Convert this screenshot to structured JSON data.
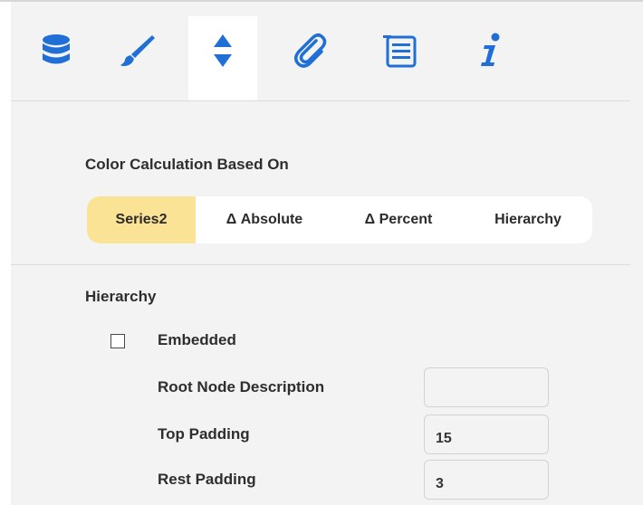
{
  "tabs": [
    {
      "icon": "database-icon",
      "active": false
    },
    {
      "icon": "brush-icon",
      "active": false
    },
    {
      "icon": "sort-arrows-icon",
      "active": true
    },
    {
      "icon": "paperclip-icon",
      "active": false
    },
    {
      "icon": "list-icon",
      "active": false
    },
    {
      "icon": "info-icon",
      "active": false
    }
  ],
  "colors": {
    "icon_blue": "#1f6fd6",
    "selected_segment": "#fbe396",
    "panel_bg": "#f3f3f3"
  },
  "color_calculation": {
    "title": "Color Calculation Based On",
    "options": [
      "Series2",
      "Δ Absolute",
      "Δ Percent",
      "Hierarchy"
    ],
    "selected": "Series2"
  },
  "hierarchy": {
    "title": "Hierarchy",
    "embedded_label": "Embedded",
    "embedded_checked": false,
    "fields": {
      "root_node_description": {
        "label": "Root Node Description",
        "value": ""
      },
      "top_padding": {
        "label": "Top Padding",
        "value": "15"
      },
      "rest_padding": {
        "label": "Rest Padding",
        "value": "3"
      }
    }
  }
}
